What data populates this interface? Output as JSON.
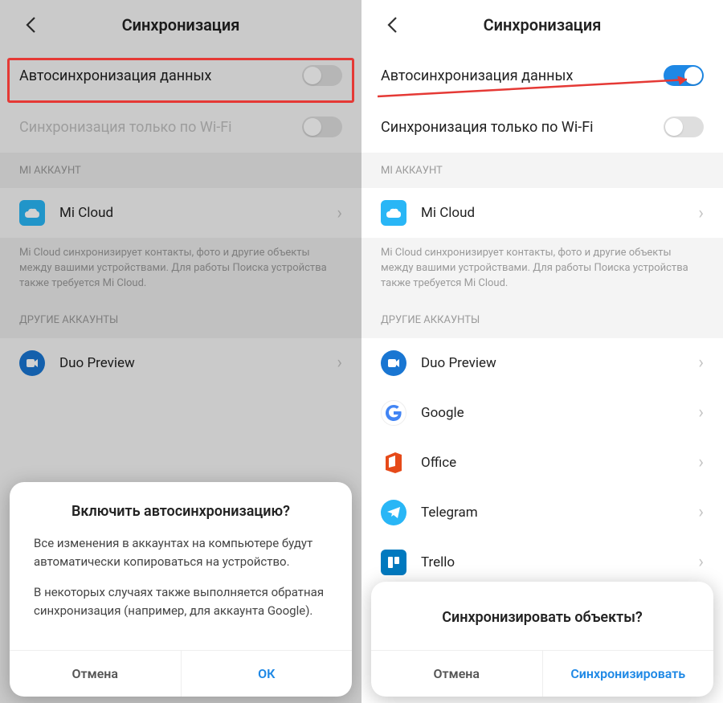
{
  "left": {
    "header_title": "Синхронизация",
    "autosync_label": "Автосинхронизация данных",
    "wifi_label": "Синхронизация только по Wi-Fi",
    "section_mi": "MI АККАУНТ",
    "mi_cloud": "Mi Cloud",
    "mi_desc": "Mi Cloud синхронизирует контакты, фото и другие объекты между вашими устройствами. Для работы Поиска устройства также требуется Mi Cloud.",
    "section_other": "ДРУГИЕ АККАУНТЫ",
    "duo": "Duo Preview",
    "dialog": {
      "title": "Включить автосинхронизацию?",
      "p1": "Все изменения в аккаунтах на компьютере будут автоматически копироваться на устройство.",
      "p2": "В некоторых случаях также выполняется обратная синхронизация (например, для аккаунта Google).",
      "cancel": "Отмена",
      "ok": "ОК"
    }
  },
  "right": {
    "header_title": "Синхронизация",
    "autosync_label": "Автосинхронизация данных",
    "wifi_label": "Синхронизация только по Wi-Fi",
    "section_mi": "MI АККАУНТ",
    "mi_cloud": "Mi Cloud",
    "mi_desc": "Mi Cloud синхронизирует контакты, фото и другие объекты между вашими устройствами. Для работы Поиска устройства также требуется Mi Cloud.",
    "section_other": "ДРУГИЕ АККАУНТЫ",
    "duo": "Duo Preview",
    "google": "Google",
    "office": "Office",
    "telegram": "Telegram",
    "trello": "Trello",
    "dialog": {
      "title": "Синхронизировать объекты?",
      "cancel": "Отмена",
      "ok": "Синхронизировать"
    }
  }
}
